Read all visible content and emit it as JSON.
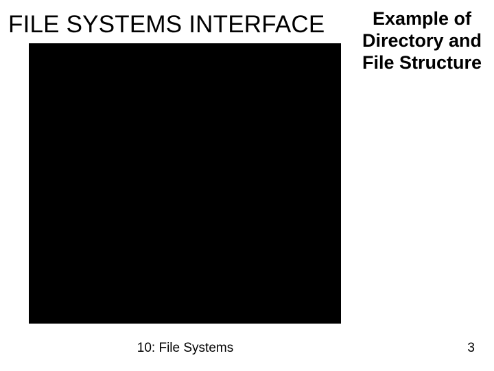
{
  "header": {
    "title": "FILE SYSTEMS INTERFACE",
    "subtitle": "Example of Directory and File Structure"
  },
  "footer": {
    "center": "10: File Systems",
    "page": "3"
  }
}
